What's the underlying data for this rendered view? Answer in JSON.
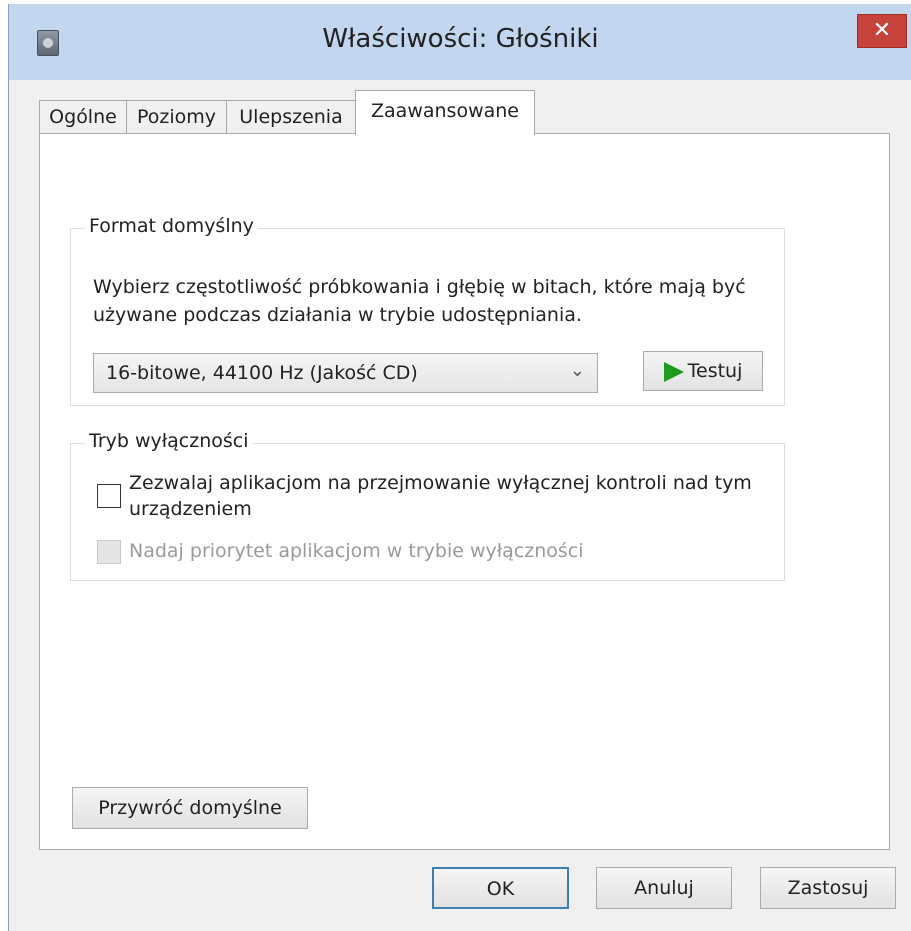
{
  "window": {
    "title": "Właściwości: Głośniki",
    "close_symbol": "✕",
    "icon": "speaker-device-icon"
  },
  "tabs": [
    {
      "label": "Ogólne",
      "active": false
    },
    {
      "label": "Poziomy",
      "active": false
    },
    {
      "label": "Ulepszenia",
      "active": false
    },
    {
      "label": "Zaawansowane",
      "active": true
    }
  ],
  "default_format": {
    "group_title": "Format domyślny",
    "description": "Wybierz częstotliwość próbkowania i głębię w bitach, które mają być używane podczas działania w trybie udostępniania.",
    "selected": "16-bitowe, 44100 Hz (Jakość CD)",
    "dropdown_arrow": "⌄",
    "test_button": "Testuj"
  },
  "exclusive_mode": {
    "group_title": "Tryb wyłączności",
    "allow_exclusive_label": "Zezwalaj aplikacjom na przejmowanie wyłącznej kontroli nad tym urządzeniem",
    "allow_exclusive_checked": false,
    "priority_label": "Nadaj priorytet aplikacjom w trybie wyłączności",
    "priority_checked": false,
    "priority_enabled": false
  },
  "restore_defaults_button": "Przywróć domyślne",
  "footer": {
    "ok": "OK",
    "cancel": "Anuluj",
    "apply": "Zastosuj"
  },
  "colors": {
    "title_bar": "#c3d6f0",
    "close_button": "#c7433b",
    "play_icon": "#1f9a1f",
    "default_button_border": "#3c7fb1"
  }
}
